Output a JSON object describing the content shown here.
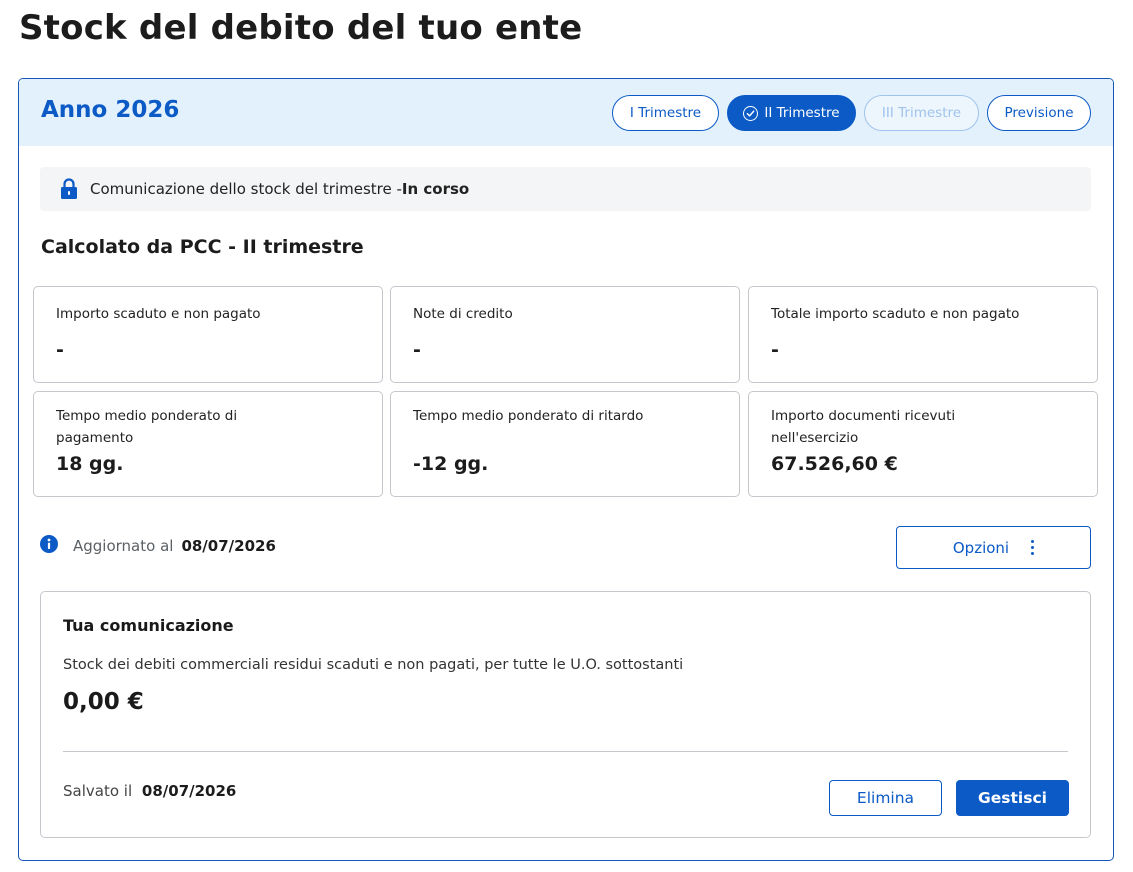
{
  "page": {
    "title": "Stock del debito del tuo ente"
  },
  "header": {
    "year_title": "Anno 2026",
    "tabs": [
      {
        "label": "I Trimestre",
        "state": "default"
      },
      {
        "label": "II Trimestre",
        "state": "active"
      },
      {
        "label": "III Trimestre",
        "state": "disabled"
      },
      {
        "label": "Previsione",
        "state": "default"
      }
    ]
  },
  "status": {
    "icon": "lock-icon",
    "text": "Comunicazione dello stock del trimestre - ",
    "state": "In corso"
  },
  "section": {
    "title": "Calcolato da PCC - II trimestre"
  },
  "metrics": [
    {
      "label": "Importo scaduto e non pagato",
      "value": "-"
    },
    {
      "label": "Note di credito",
      "value": "-"
    },
    {
      "label": "Totale importo scaduto e non pagato",
      "value": "-"
    },
    {
      "label": "Tempo medio ponderato di pagamento",
      "value": "18 gg."
    },
    {
      "label": "Tempo medio ponderato di ritardo",
      "value": "-12 gg."
    },
    {
      "label": "Importo documenti ricevuti nell'esercizio",
      "value": "67.526,60 €"
    }
  ],
  "updated": {
    "label": "Aggiornato al",
    "date": "08/07/2026"
  },
  "options": {
    "label": "Opzioni"
  },
  "communication": {
    "title": "Tua comunicazione",
    "description": "Stock dei debiti commerciali residui scaduti e non pagati, per tutte le U.O. sottostanti",
    "amount": "0,00 €",
    "saved_label": "Salvato il",
    "saved_date": "08/07/2026",
    "delete_label": "Elimina",
    "manage_label": "Gestisci"
  },
  "colors": {
    "primary": "#0b5ac6",
    "header_bg": "#e3f1fc",
    "border": "#c4c8cc",
    "status_bg": "#f4f5f6"
  }
}
